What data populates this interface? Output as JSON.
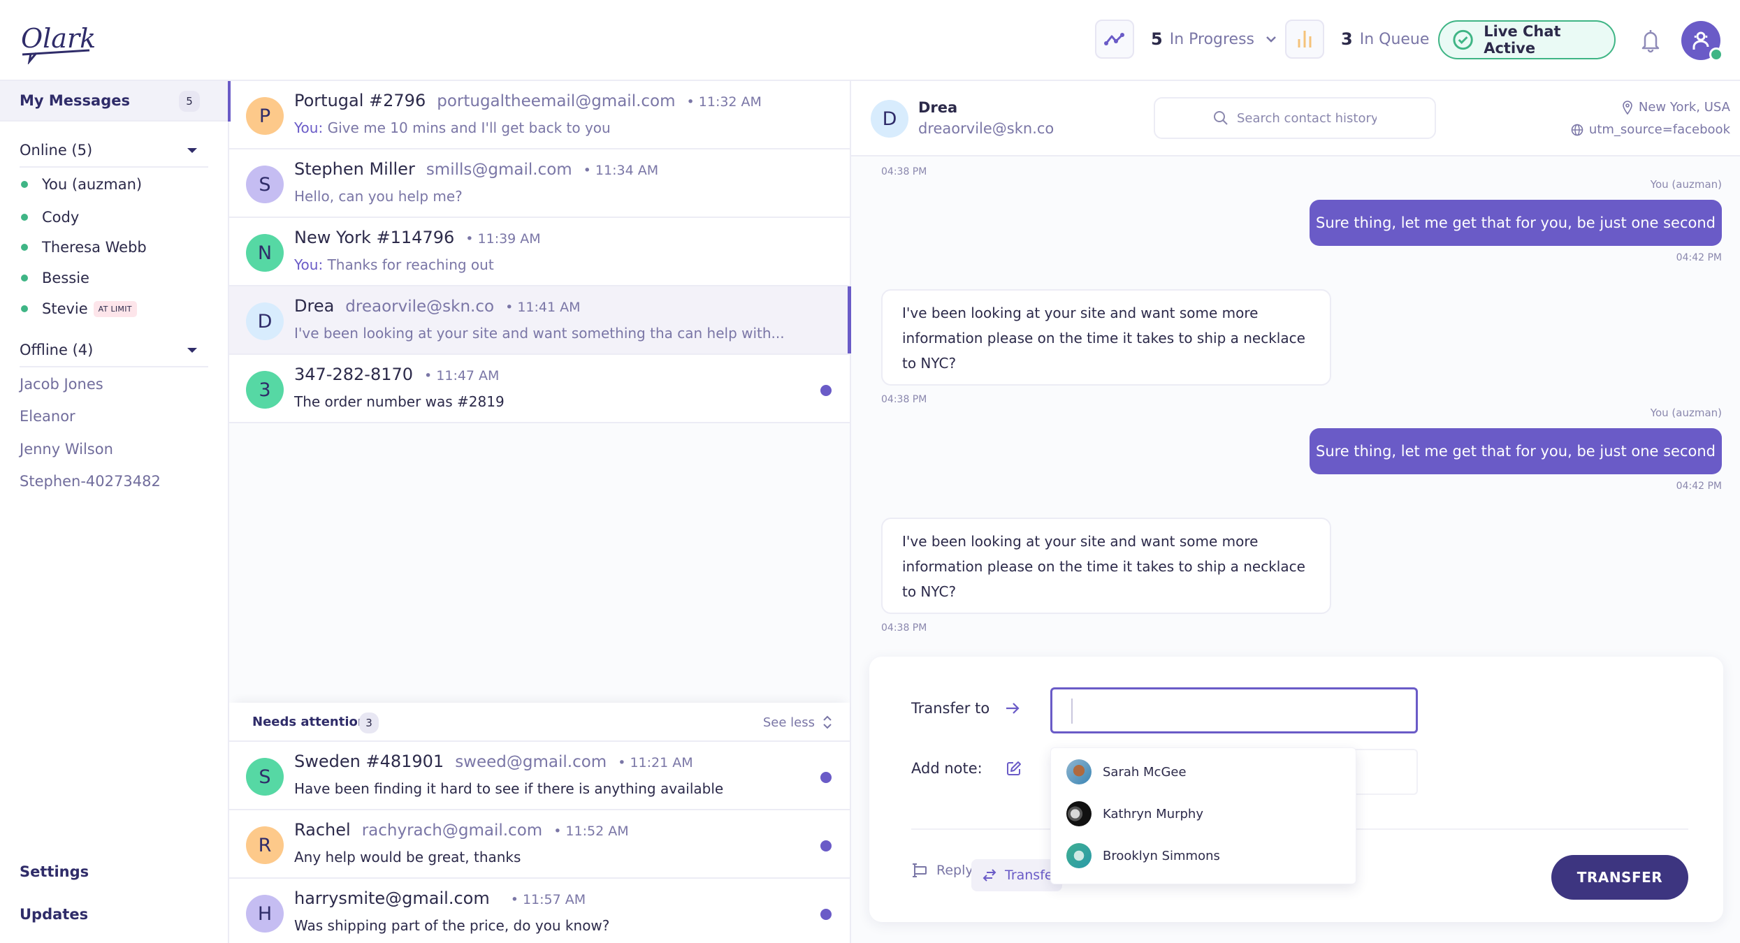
{
  "app": {
    "name": "Olark"
  },
  "header": {
    "in_progress": {
      "count": "5",
      "label": "In Progress"
    },
    "in_queue": {
      "count": "3",
      "label": "In Queue"
    },
    "live_chat": {
      "label": "Live Chat Active"
    },
    "colors": {
      "accent": "#6a5bc7",
      "success": "#3fb585",
      "queue": "#f5c27a"
    }
  },
  "sidebar": {
    "my_messages": {
      "label": "My Messages",
      "count": "5"
    },
    "online": {
      "label": "Online (5)",
      "agents": [
        {
          "name": "You (auzman)"
        },
        {
          "name": "Cody"
        },
        {
          "name": "Theresa Webb"
        },
        {
          "name": "Bessie"
        },
        {
          "name": "Stevie",
          "badge": "AT LIMIT"
        }
      ]
    },
    "offline": {
      "label": "Offline (4)",
      "agents": [
        "Jacob Jones",
        "Eleanor",
        "Jenny Wilson",
        "Stephen-40273482"
      ]
    },
    "links": {
      "settings": "Settings",
      "updates": "Updates"
    }
  },
  "conversations": [
    {
      "initial": "P",
      "name": "Portugal #2796",
      "email": "portugaltheemail@gmail.com",
      "time": "• 11:32 AM",
      "prefix": "You:",
      "preview": " Give me 10 mins and I'll get back to you",
      "avatar_color": "#fdc98a"
    },
    {
      "initial": "S",
      "name": "Stephen Miller",
      "email": "smills@gmail.com",
      "time": "• 11:34 AM",
      "prefix": "",
      "preview": "Hello, can you help me?",
      "avatar_color": "#c5bdf2"
    },
    {
      "initial": "N",
      "name": "New York #114796",
      "email": "",
      "time": "• 11:39 AM",
      "prefix": "You:",
      "preview": " Thanks for reaching out",
      "avatar_color": "#56d8a4"
    },
    {
      "initial": "D",
      "name": "Drea",
      "email": "dreaorvile@skn.co",
      "time": "• 11:41 AM",
      "prefix": "",
      "preview": "I've been looking at your site and want something tha can help with...",
      "avatar_color": "#d8ecfd",
      "active": true
    },
    {
      "initial": "3",
      "name": "347-282-8170",
      "email": "",
      "time": "• 11:47 AM",
      "prefix": "",
      "preview": "The order number was #2819",
      "avatar_color": "#56d8a4",
      "unread": true
    }
  ],
  "needs_attention": {
    "label": "Needs attention",
    "count": "3",
    "toggle": "See less",
    "items": [
      {
        "initial": "S",
        "name": "Sweden #481901",
        "email": "sweed@gmail.com",
        "time": "• 11:21 AM",
        "preview": "Have been finding it hard to see if there is anything available",
        "avatar_color": "#56d8a4",
        "unread": true
      },
      {
        "initial": "R",
        "name": "Rachel",
        "email": "rachyrach@gmail.com",
        "time": "• 11:52 AM",
        "preview": "Any help would be great, thanks",
        "avatar_color": "#fdc98a",
        "unread": true
      },
      {
        "initial": "H",
        "name": "harrysmite@gmail.com",
        "email": "",
        "time": "• 11:57 AM",
        "preview": "Was shipping part of the price, do you know?",
        "avatar_color": "#c5bdf2",
        "unread": true
      }
    ]
  },
  "chat": {
    "contact": {
      "initial": "D",
      "name": "Drea",
      "email": "dreaorvile@skn.co"
    },
    "search_placeholder": "Search contact history",
    "location": "New York, USA",
    "utm": "utm_source=facebook",
    "messages": [
      {
        "type": "time",
        "text": "04:38 PM"
      },
      {
        "type": "out",
        "sender": "You (auzman)",
        "text": "Sure thing, let me get that for you, be just one second",
        "time": "04:42 PM"
      },
      {
        "type": "in",
        "text": "I've been looking at your site and want some more information please on the time it takes to ship a necklace to NYC?",
        "time": "04:38 PM"
      },
      {
        "type": "out",
        "sender": "You (auzman)",
        "text": "Sure thing, let me get that for you, be just one second",
        "time": "04:42 PM"
      },
      {
        "type": "in",
        "text": "I've been looking at your site and want some more information please on the time it takes to ship a necklace to NYC?",
        "time": "04:38 PM"
      }
    ]
  },
  "transfer": {
    "transfer_to_label": "Transfer to",
    "transfer_to_value": "",
    "add_note_label": "Add note:",
    "tabs": {
      "reply": "Reply",
      "transfer": "Transfer"
    },
    "button": "TRANSFER",
    "suggestions": [
      "Sarah McGee",
      "Kathryn Murphy",
      "Brooklyn Simmons"
    ]
  }
}
